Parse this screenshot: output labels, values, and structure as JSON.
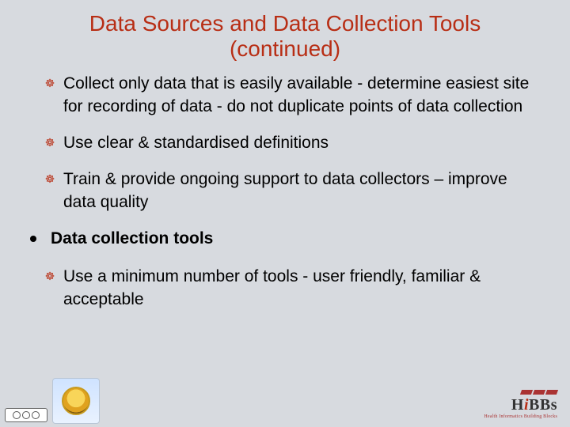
{
  "title": "Data Sources and Data Collection Tools (continued)",
  "bullets": {
    "b1": "Collect only data that is easily available - determine easiest site for recording of data - do not duplicate points of data collection",
    "b2": "Use clear & standardised definitions",
    "b3": "Train & provide ongoing support to data collectors – improve data quality",
    "b4": "Data collection tools",
    "b5": "Use a minimum number of tools - user friendly, familiar & acceptable"
  },
  "bullet_glyph": "☸",
  "logos": {
    "hibbs_text_h": "H",
    "hibbs_text_i": "i",
    "hibbs_text_bbs": "BBs",
    "hibbs_tagline": "Health Informatics Building Blocks"
  }
}
